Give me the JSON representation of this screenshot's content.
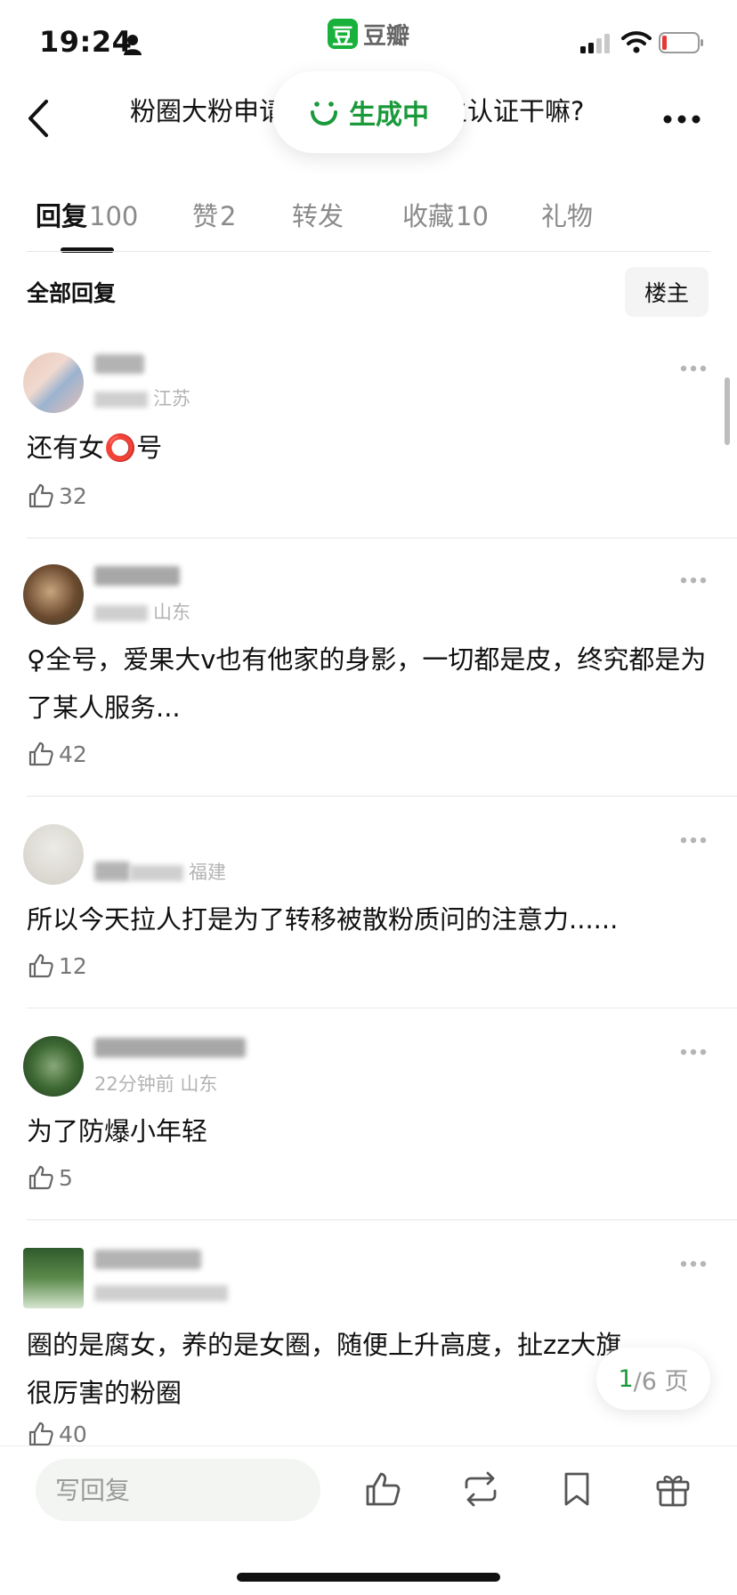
{
  "status_bar": {
    "time": "19:24",
    "app_name": "豆瓣",
    "app_logo_text": "豆"
  },
  "nav": {
    "title_left": "粉圈大粉申请",
    "title_right": "主认证干嘛?"
  },
  "generating": {
    "label": "生成中"
  },
  "tabs": [
    {
      "label": "回复",
      "count": "100",
      "active": true
    },
    {
      "label": "赞",
      "count": "2",
      "active": false
    },
    {
      "label": "转发",
      "count": "",
      "active": false
    },
    {
      "label": "收藏",
      "count": "10",
      "active": false
    },
    {
      "label": "礼物",
      "count": "",
      "active": false
    }
  ],
  "filter": {
    "title": "全部回复",
    "op_button": "楼主"
  },
  "comments": [
    {
      "location": "江苏",
      "text": "还有女⭕号",
      "likes": "32"
    },
    {
      "location": "山东",
      "text": "♀全号，爱果大v也有他家的身影，一切都是皮，终究都是为了某人服务...",
      "likes": "42"
    },
    {
      "location": "福建",
      "text": "所以今天拉人打是为了转移被散粉质问的注意力......",
      "likes": "12"
    },
    {
      "location": "22分钟前 山东",
      "text": "为了防爆小年轻",
      "likes": "5"
    },
    {
      "location": "",
      "text": "圈的是腐女，养的是女圈，随便上升高度，扯zz大旗，很厉害的粉圈",
      "likes": "40"
    }
  ],
  "pagination": {
    "current": "1",
    "total": "/6 页"
  },
  "bottom_bar": {
    "reply_placeholder": "写回复"
  },
  "colors": {
    "brand_green": "#18b13c",
    "accent_green": "#1a9a3a"
  },
  "icons": [
    "person-icon",
    "signal-icon",
    "wifi-icon",
    "battery-icon",
    "back-icon",
    "more-icon",
    "thumb-up-icon",
    "repost-icon",
    "bookmark-icon",
    "gift-icon"
  ]
}
